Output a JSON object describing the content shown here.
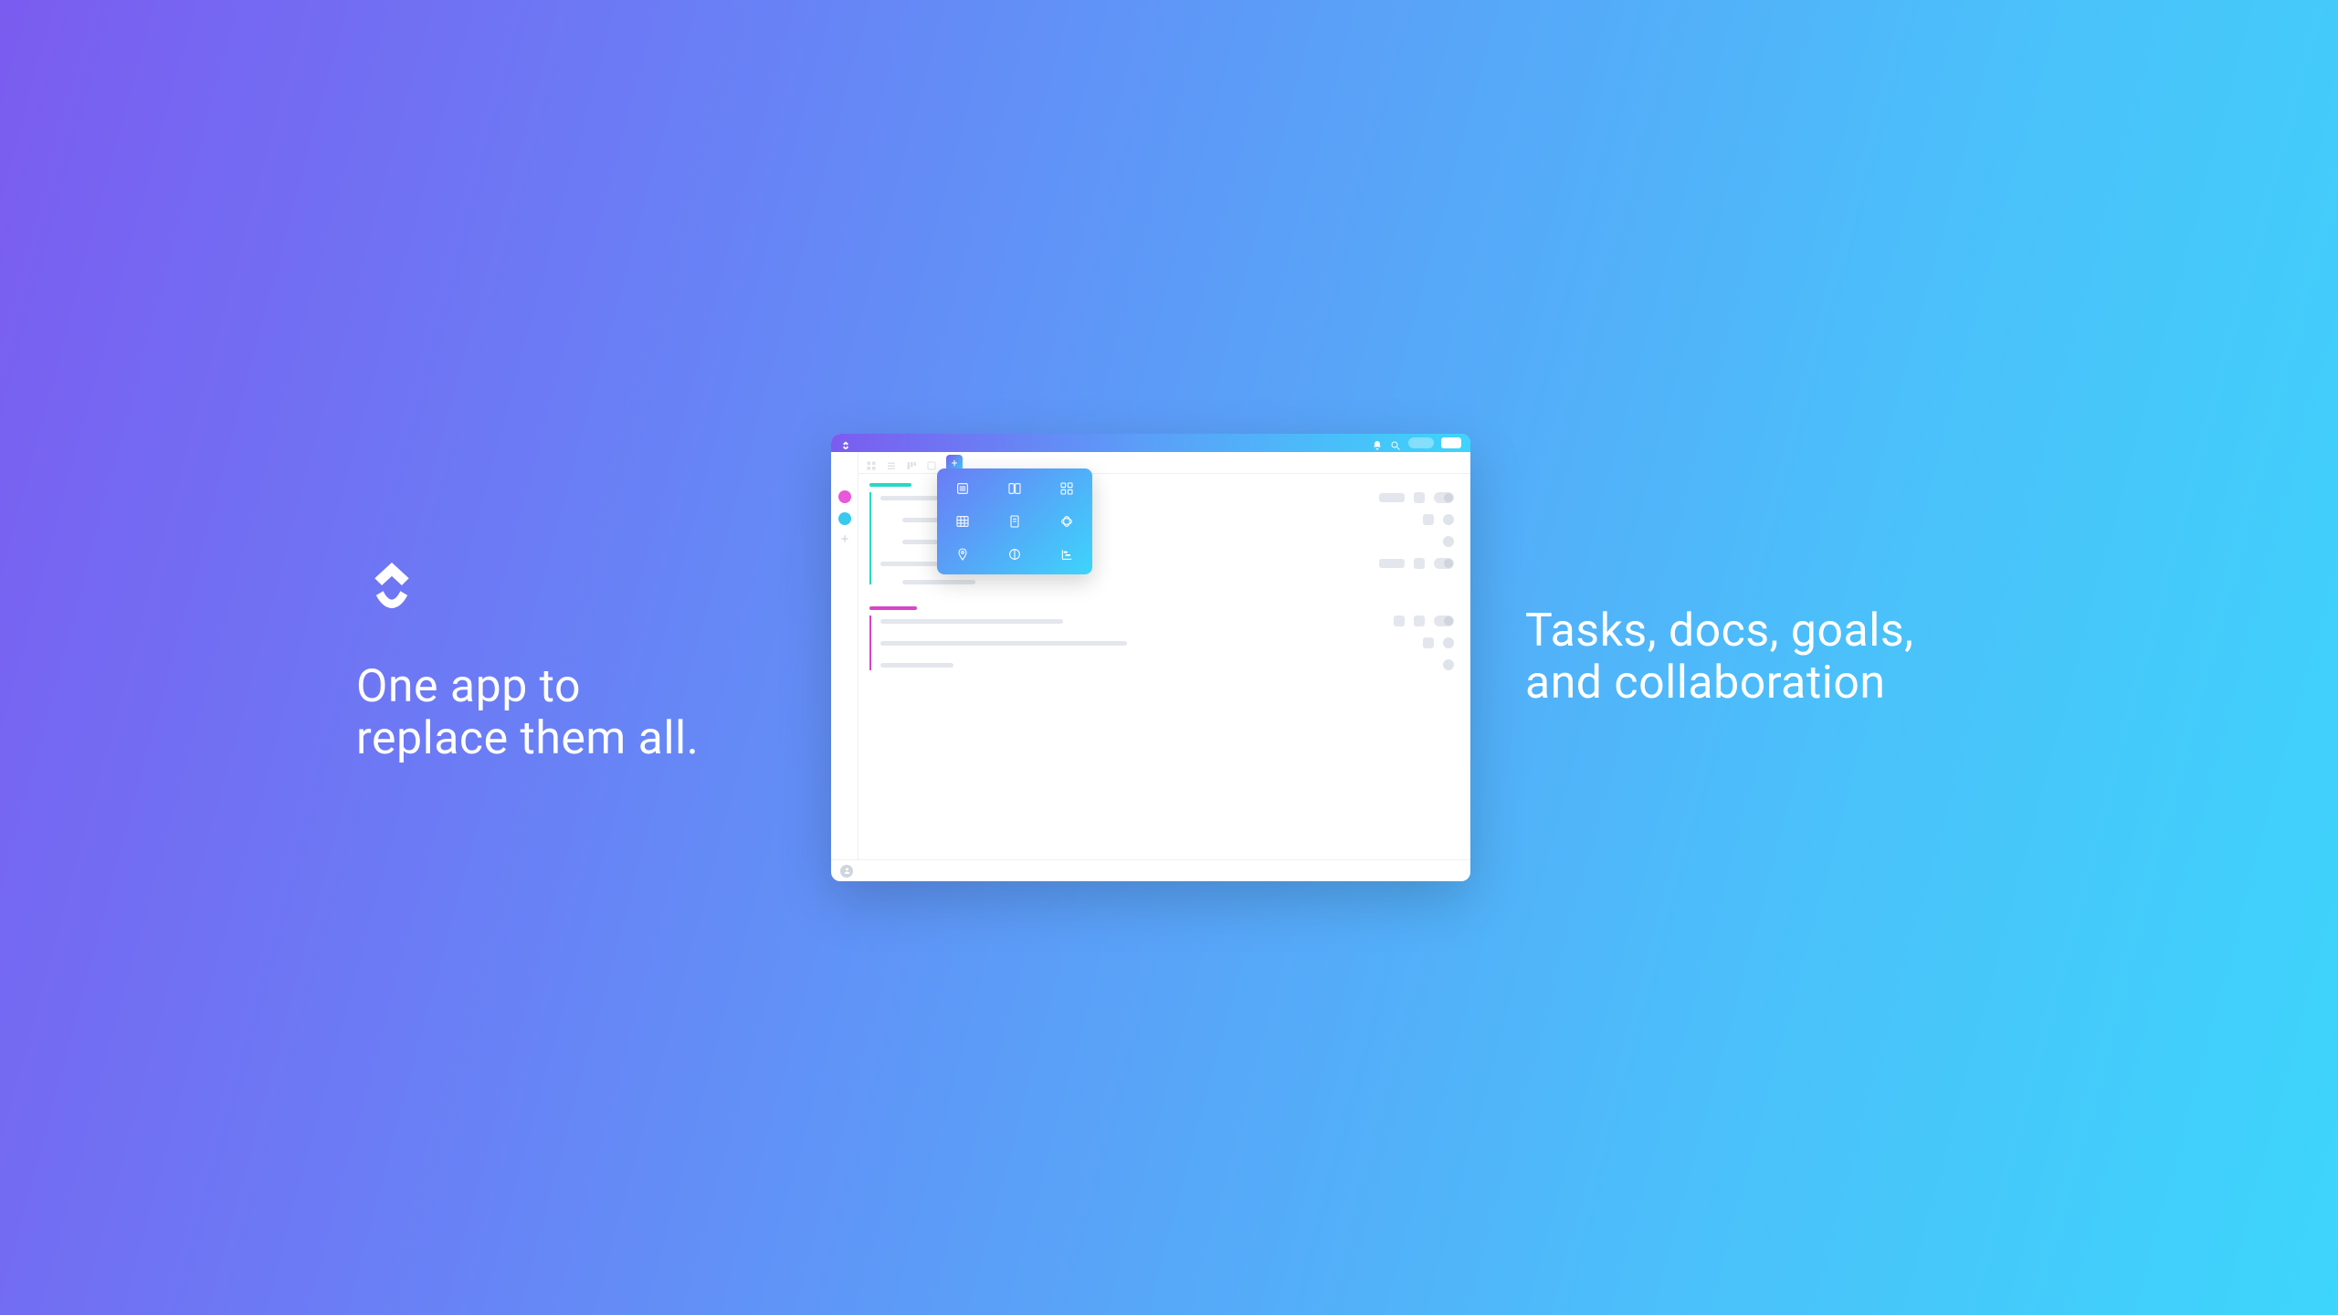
{
  "left": {
    "tagline_line1": "One app to",
    "tagline_line2": "replace them all."
  },
  "right": {
    "tagline_line1": "Tasks, docs, goals,",
    "tagline_line2": "and collaboration"
  },
  "app": {
    "titlebar": {
      "icons": [
        "bell-icon",
        "search-icon"
      ]
    },
    "rail": {
      "plus_label": "+"
    },
    "tabs": {
      "plus_label": "+"
    },
    "view_popup": {
      "items": [
        "list",
        "board",
        "box",
        "table",
        "doc",
        "embed",
        "map",
        "activity",
        "gantt"
      ]
    }
  }
}
